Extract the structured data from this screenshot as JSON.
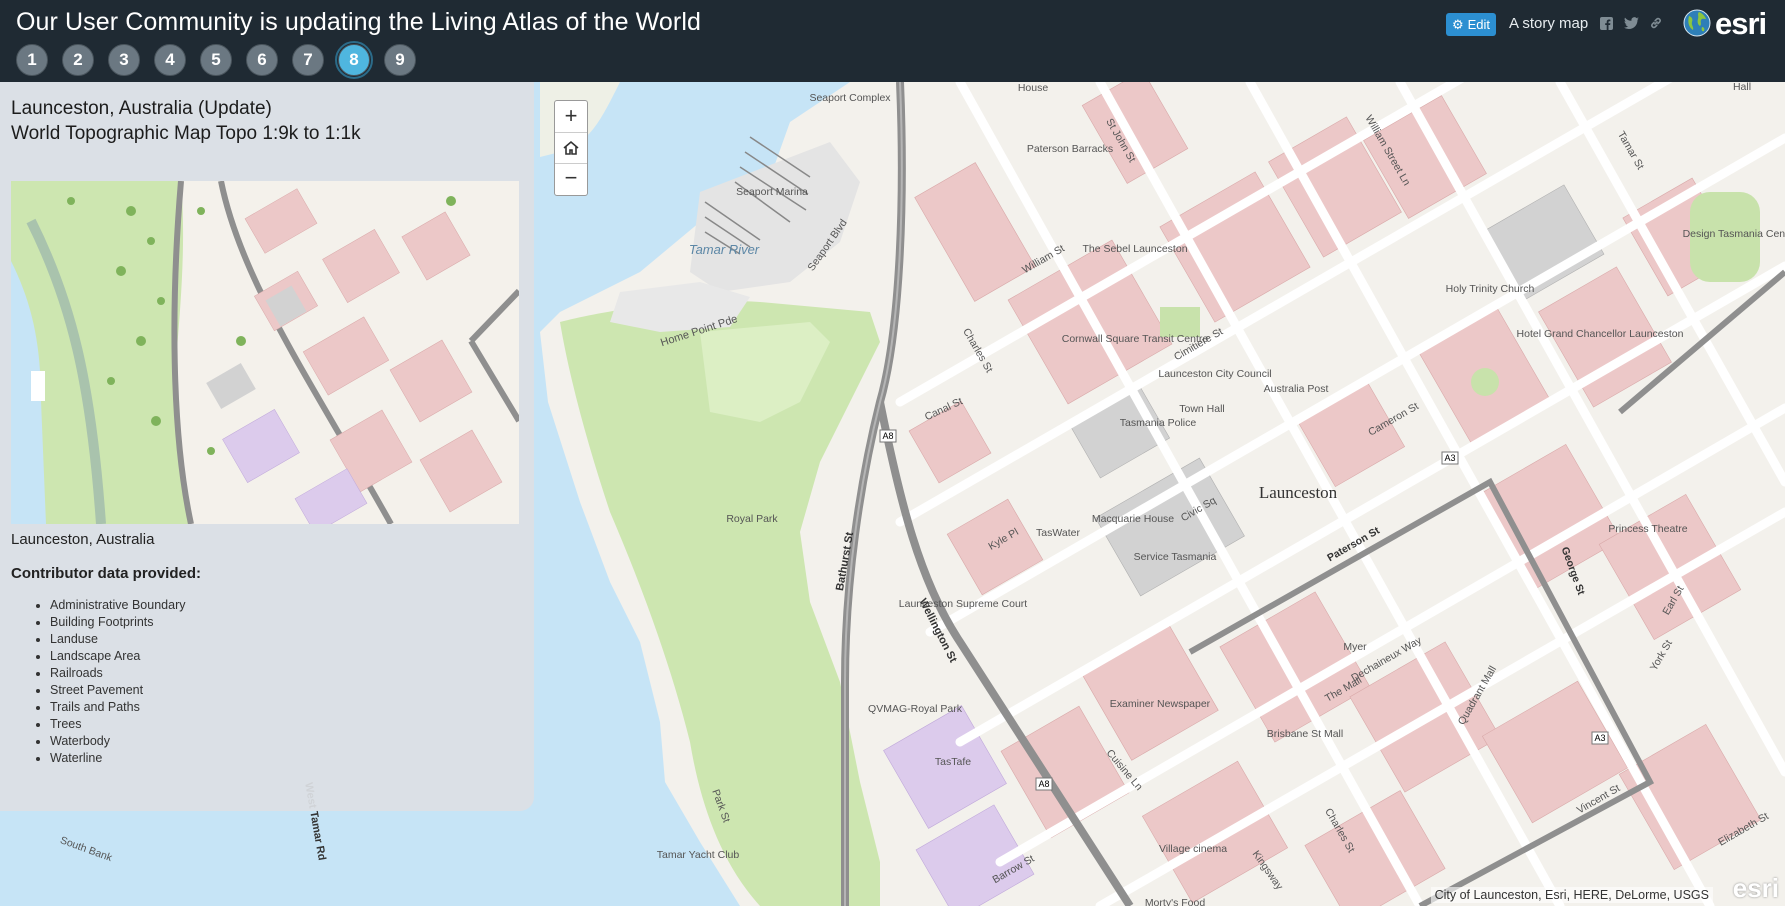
{
  "header": {
    "title": "Our User Community is updating the Living Atlas of the World",
    "tabs": [
      "1",
      "2",
      "3",
      "4",
      "5",
      "6",
      "7",
      "8",
      "9"
    ],
    "active_tab": "8",
    "edit_label": "Edit",
    "storymap_label": "A story map",
    "logo_text": "esri"
  },
  "panel": {
    "title_line1": "Launceston, Australia (Update)",
    "title_line2": "World Topographic Map Topo 1:9k to 1:1k",
    "caption": "Launceston, Australia",
    "contributor_heading": "Contributor data provided:",
    "contributor_items": [
      "Administrative Boundary",
      "Building Footprints",
      "Landuse",
      "Landscape Area",
      "Railroads",
      "Street Pavement",
      "Trails and Paths",
      "Trees",
      "Waterbody",
      "Waterline"
    ]
  },
  "map": {
    "zoom_in": "+",
    "zoom_out": "−",
    "attribution": "City of Launceston, Esri, HERE, DeLorme, USGS",
    "corner_logo": "esri",
    "labels": {
      "tamar_river": "Tamar River",
      "seaport_complex": "Seaport Complex",
      "seaport_marina": "Seaport Marina",
      "seaport_blvd": "Seaport Blvd",
      "home_point_pde": "Home Point Pde",
      "royal_park": "Royal Park",
      "bathurst_st": "Bathurst St",
      "wellington_st": "Wellington St",
      "canal_st": "Canal St",
      "charles_st": "Charles St",
      "paterson_barracks": "Paterson Barracks",
      "william_st": "William St",
      "william_street_ln": "William Street Ln",
      "st_john_st": "St John St",
      "sebel": "The Sebel Launceston",
      "cornwall_square": "Cornwall Square Transit Centre",
      "cimitiere_st": "Cimitiere St",
      "city_council": "Launceston City Council",
      "town_hall": "Town Hall",
      "australia_post": "Australia Post",
      "tasmania_police": "Tasmania Police",
      "launceston": "Launceston",
      "macquarie_house": "Macquarie House",
      "civic_sq": "Civic Sq",
      "service_tasmania": "Service Tasmania",
      "taswater": "TasWater",
      "kyle_pl": "Kyle Pl",
      "supreme_court": "Launceston Supreme Court",
      "paterson_st": "Paterson St",
      "george_st": "George St",
      "cameron_st": "Cameron St",
      "holy_trinity": "Holy Trinity Church",
      "hotel_grand": "Hotel Grand Chancellor Launceston",
      "design_tasmania": "Design Tasmania Centre",
      "tamar_st": "Tamar St",
      "princess_theatre": "Princess Theatre",
      "myer": "Myer",
      "examiner": "Examiner Newspaper",
      "brisbane_st_mall": "Brisbane St Mall",
      "the_mall": "The Mall",
      "quadrant_mall": "Quadrant Mall",
      "qvmag": "QVMAG-Royal Park",
      "tastafe": "TasTafe",
      "cuisine_ln": "Cuisine Ln",
      "village_cinema": "Village cinema",
      "kingsway": "Kingsway",
      "barrow_st": "Barrow St",
      "tamar_yacht_club": "Tamar Yacht Club",
      "a8": "A8",
      "a3": "A3",
      "house": "House",
      "hall": "Hall",
      "charles_st2": "Charles St",
      "dechaineux_way": "Dechaineux Way",
      "york_st": "York St",
      "earl_st": "Earl St",
      "elizabeth_st": "Elizabeth St",
      "vincent_st": "Vincent St",
      "mortys_food": "Morty's Food",
      "park_st": "Park St",
      "westtamar_rd": "West Tamar Rd",
      "south_bank": "South Bank"
    }
  },
  "colors": {
    "header_bg": "#1f2a33",
    "active_tab": "#4fb6df",
    "edit_btn": "#2c8fd1",
    "water": "#bfe1f5",
    "park": "#c9e3ad",
    "building": "#ebc7c7",
    "road": "#ffffff",
    "highway": "#8f8f8f"
  }
}
